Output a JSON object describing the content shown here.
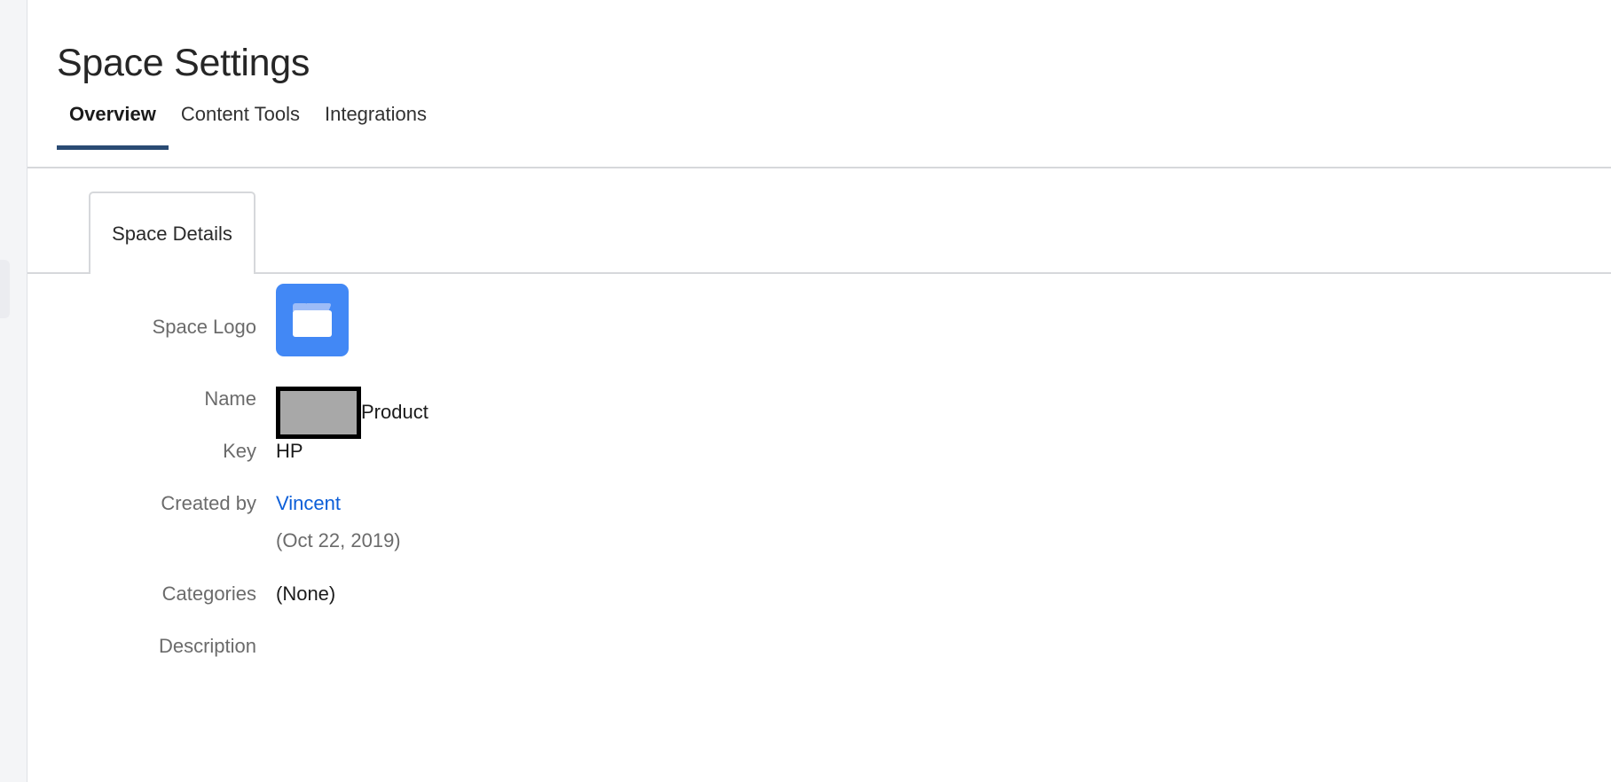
{
  "page": {
    "title": "Space Settings"
  },
  "tabs": [
    {
      "label": "Overview",
      "active": true
    },
    {
      "label": "Content Tools",
      "active": false
    },
    {
      "label": "Integrations",
      "active": false
    }
  ],
  "subtab": {
    "label": "Space Details"
  },
  "details": {
    "logo": {
      "label": "Space Logo",
      "icon": "folder-icon",
      "background_color": "#4288f5",
      "folder_color": "#ffffff",
      "folder_tab_color": "#9dbcf7"
    },
    "name": {
      "label": "Name",
      "redacted": true,
      "value": "Product"
    },
    "key": {
      "label": "Key",
      "value": "HP"
    },
    "created_by": {
      "label": "Created by",
      "value": "Vincent",
      "link_color": "#0b5ed8",
      "date": "(Oct 22, 2019)"
    },
    "categories": {
      "label": "Categories",
      "value": "(None)"
    },
    "description": {
      "label": "Description",
      "value": ""
    }
  },
  "colors": {
    "active_tab_underline": "#2a4b73",
    "border": "#d6d8db",
    "sidebar_background": "#f4f5f7",
    "label_text": "#6b6b6b",
    "value_text": "#1b1b1b"
  }
}
